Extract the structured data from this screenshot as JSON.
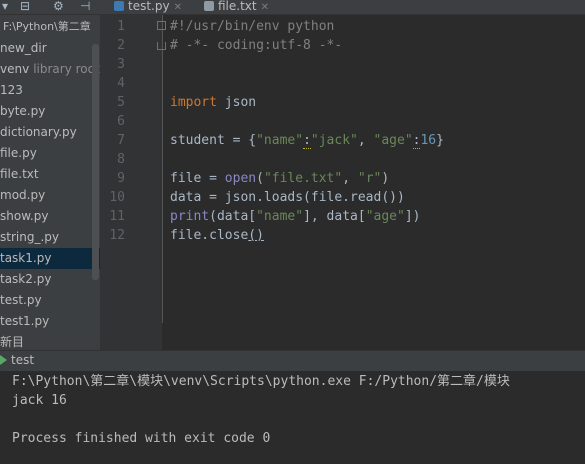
{
  "project": {
    "root_label": "F:\\Python\\第二章",
    "items": [
      {
        "label": "new_dir"
      },
      {
        "label": "venv",
        "note": "library root"
      },
      {
        "label": "123"
      },
      {
        "label": "byte.py"
      },
      {
        "label": "dictionary.py"
      },
      {
        "label": "file.py"
      },
      {
        "label": "file.txt"
      },
      {
        "label": "mod.py"
      },
      {
        "label": "show.py"
      },
      {
        "label": "string_.py"
      },
      {
        "label": "task1.py",
        "selected": true
      },
      {
        "label": "task2.py"
      },
      {
        "label": "test.py"
      },
      {
        "label": "test1.py"
      },
      {
        "label": "新目"
      }
    ]
  },
  "tabs": [
    {
      "label": "test.py",
      "active": true,
      "icon_color": "#3d7ab3"
    },
    {
      "label": "file.txt",
      "active": false,
      "icon_color": "#8f9aa3"
    }
  ],
  "editor": {
    "line_numbers": [
      "1",
      "2",
      "3",
      "4",
      "5",
      "6",
      "7",
      "8",
      "9",
      "10",
      "11",
      "12"
    ],
    "lines": [
      [
        {
          "t": "#!/usr/bin/env python",
          "c": "cmt"
        }
      ],
      [
        {
          "t": "# -*- coding:utf-8 -*-",
          "c": "cmt"
        }
      ],
      [],
      [],
      [
        {
          "t": "import",
          "c": "kw"
        },
        {
          "t": " json",
          "c": ""
        }
      ],
      [],
      [
        {
          "t": "student = {",
          "c": ""
        },
        {
          "t": "\"name\"",
          "c": "str"
        },
        {
          "t": ":",
          "c": "squig"
        },
        {
          "t": "\"jack\"",
          "c": "str"
        },
        {
          "t": ", ",
          "c": ""
        },
        {
          "t": "\"age\"",
          "c": "str"
        },
        {
          "t": ":",
          "c": "squig"
        },
        {
          "t": "16",
          "c": "num"
        },
        {
          "t": "}",
          "c": ""
        }
      ],
      [],
      [
        {
          "t": "file = ",
          "c": ""
        },
        {
          "t": "open",
          "c": "bi"
        },
        {
          "t": "(",
          "c": ""
        },
        {
          "t": "\"file.txt\"",
          "c": "str"
        },
        {
          "t": ", ",
          "c": ""
        },
        {
          "t": "\"r\"",
          "c": "str"
        },
        {
          "t": ")",
          "c": ""
        }
      ],
      [
        {
          "t": "data = json.loads(file.read())",
          "c": ""
        }
      ],
      [
        {
          "t": "print",
          "c": "bi"
        },
        {
          "t": "(data[",
          "c": ""
        },
        {
          "t": "\"name\"",
          "c": "str"
        },
        {
          "t": "], data[",
          "c": ""
        },
        {
          "t": "\"age\"",
          "c": "str"
        },
        {
          "t": "])",
          "c": ""
        }
      ],
      [
        {
          "t": "file.close",
          "c": ""
        },
        {
          "t": "()",
          "c": "underline"
        }
      ]
    ]
  },
  "run": {
    "tab_label": "test",
    "output": [
      "F:\\Python\\第二章\\模块\\venv\\Scripts\\python.exe F:/Python/第二章/模块",
      "jack 16",
      "",
      "Process finished with exit code 0"
    ]
  },
  "colors": {
    "accent": "#4a88c7",
    "run_icon": "#59a869"
  }
}
